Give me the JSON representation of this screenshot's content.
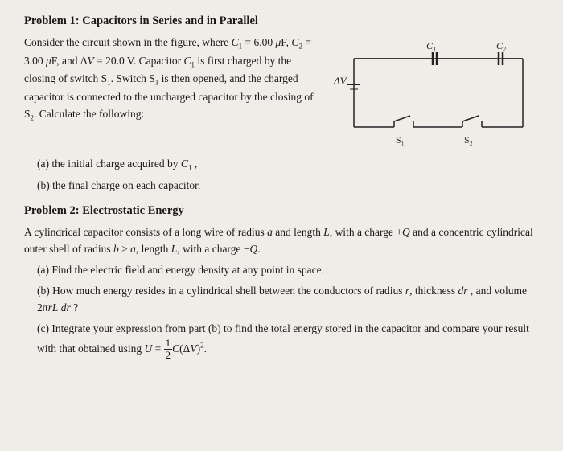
{
  "problem1": {
    "title": "Problem 1: Capacitors in Series and in Parallel",
    "description": "Consider the circuit shown in the figure, where C₁ = 6.00 μF, C₂ = 3.00 μF, and ΔV = 20.0 V. Capacitor C₁ is first charged by the closing of switch S₁. Switch S₁ is then opened, and the charged capacitor is connected to the uncharged capacitor by the closing of S₂. Calculate the following:",
    "sub_a": "(a) the initial charge acquired by C₁ ,",
    "sub_b": "(b) the final charge on each capacitor."
  },
  "problem2": {
    "title": "Problem 2: Electrostatic Energy",
    "description": "A cylindrical capacitor consists of a long wire of radius a and length L, with a charge +Q and a concentric cylindrical outer shell of radius b > a, length L, with a charge −Q.",
    "sub_a": "(a) Find the electric field and energy density at any point in space.",
    "sub_b": "(b) How much energy resides in a cylindrical shell between the conductors of radius r, thickness dr , and volume 2πrL dr ?",
    "sub_c": "(c) Integrate your expression from part (b) to find the total energy stored in the capacitor and compare your result with that obtained using U = ½C(ΔV)²."
  }
}
